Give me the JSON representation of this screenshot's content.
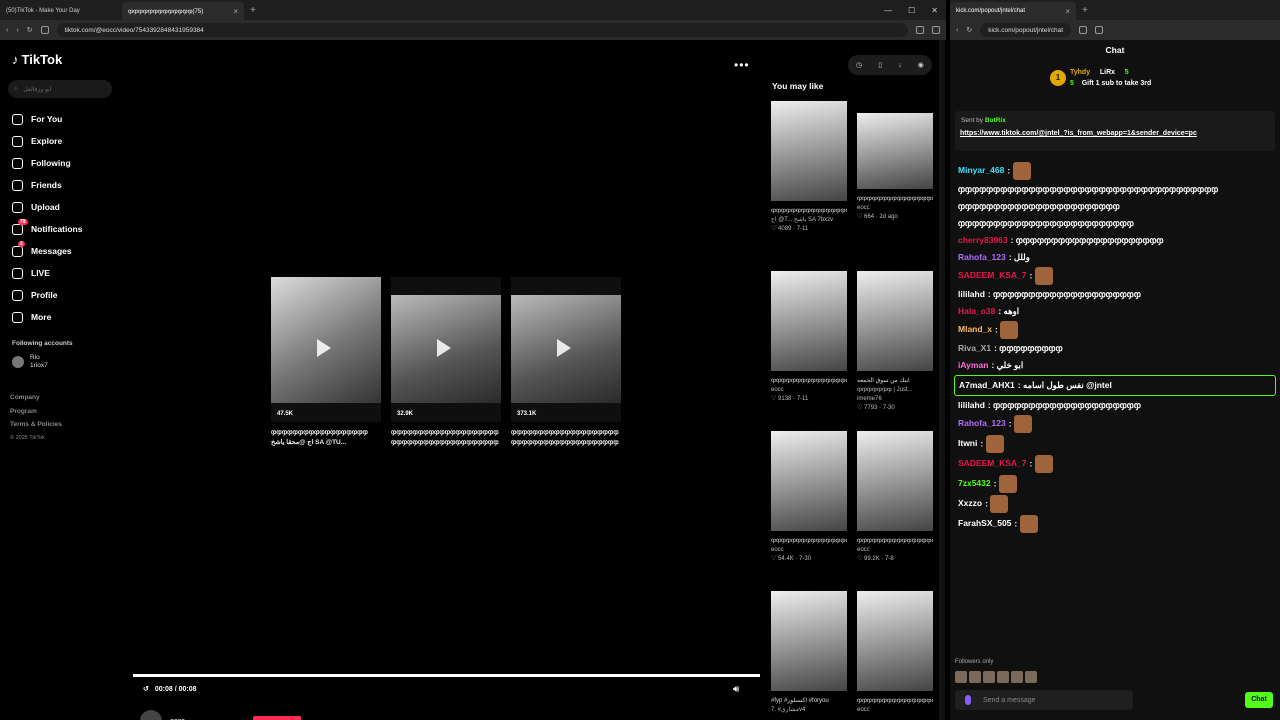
{
  "left_window": {
    "tabs": [
      {
        "label": "(50)TikTok - Make Your Day",
        "active": false
      },
      {
        "label": "ჶჶჶჶჶჶჶჶჶჶჶჶჶ(75)",
        "active": true
      }
    ],
    "url": "tiktok.com/@eocc/video/7543392848431959384"
  },
  "tiktok": {
    "logo": "TikTok",
    "search_placeholder": "ابو وزقالقل",
    "nav": [
      {
        "label": "For You",
        "icon": "home-icon"
      },
      {
        "label": "Explore",
        "icon": "compass-icon"
      },
      {
        "label": "Following",
        "icon": "following-icon"
      },
      {
        "label": "Friends",
        "icon": "friends-icon"
      },
      {
        "label": "Upload",
        "icon": "plus-square-icon"
      },
      {
        "label": "Notifications",
        "icon": "inbox-icon",
        "badge": "78"
      },
      {
        "label": "Messages",
        "icon": "send-icon",
        "badge": "2"
      },
      {
        "label": "LIVE",
        "icon": "live-icon"
      },
      {
        "label": "Profile",
        "icon": "profile-icon"
      },
      {
        "label": "More",
        "icon": "more-icon"
      }
    ],
    "following_header": "Following accounts",
    "following": [
      {
        "name": "Rio",
        "handle": "1riox7"
      }
    ],
    "footer": [
      "Company",
      "Program",
      "Terms & Policies"
    ],
    "copyright": "© 2025 TikTok",
    "cards": [
      {
        "views": "47.5K",
        "line1": "ჶჶჶჶჶჶჶჶჶჶჶჶჶჶჶჶჶჶ",
        "line2": "اج @محقا ياشخ SA @TU..."
      },
      {
        "views": "32.9K",
        "line1": "ჶჶჶჶჶჶჶჶჶჶჶჶჶჶჶჶჶჶჶჶ",
        "line2": "ჶჶჶჶჶჶჶჶჶჶჶჶჶჶჶჶჶჶჶჶ"
      },
      {
        "views": "373.1K",
        "line1": "ჶჶჶჶჶჶჶჶჶჶჶჶჶჶჶჶჶჶჶჶ",
        "line2": "ჶჶჶჶჶჶჶჶჶჶჶჶჶჶჶჶჶჶჶჶ"
      }
    ],
    "time": "00:08 / 00:08",
    "creator": "eocc",
    "you_may_like": "You may like",
    "suggestions": [
      {
        "t1": "ჶჶჶჶჶჶჶჶჶჶჶჶჶჶჶჶ",
        "t2": "اج @T... ياشخ SA 7bxzv",
        "meta": "♡ 4089 · 7-11"
      },
      {
        "t1": "ჶჶჶჶჶჶჶჶჶჶჶჶჶჶჶჶ",
        "t2": "eocc",
        "meta": "♡ 664 · 2d ago"
      },
      {
        "t1": "ჶჶჶჶჶჶჶჶჶჶჶჶჶჶჶჶ",
        "t2": "eocc",
        "meta": "♡ 9138 · 7-11"
      },
      {
        "t1": "ابيك من سوق الجمعه",
        "t2": "ჶჶჶჶჶჶჶ | Just... imeme76",
        "meta": "♡ 7793 · 7-30"
      },
      {
        "t1": "ჶჶჶჶჶჶჶჶჶჶჶჶჶჶჶჶ",
        "t2": "eocc",
        "meta": "♡ 54.4K · 7-30"
      },
      {
        "t1": "ჶჶჶჶჶჶჶჶჶჶჶჶჶჶჶჶ",
        "t2": "eocc",
        "meta": "♡ 99.2K · 7-8"
      },
      {
        "t1": "#fyp #اكسبلور #foryou",
        "t2": "مشاري# .7v4",
        "meta": ""
      },
      {
        "t1": "ჶჶჶჶჶჶჶჶჶჶჶჶჶჶჶჶ",
        "t2": "eocc",
        "meta": ""
      }
    ]
  },
  "right_window": {
    "url": "kick.com/popout/jntel/chat",
    "tab_label": "kick.com/popout/jntel/chat",
    "chat_title": "Chat",
    "gift": {
      "user": "Tyhdy",
      "count": "5",
      "other": "LiRx",
      "other_count": "5",
      "text": "Gift 1 sub to take 3rd",
      "rank": "1"
    },
    "pinned": {
      "sent_by": "Sent by",
      "bot": "BotRix",
      "link": "https://www.tiktok.com/@jntel_?is_from_webapp=1&sender_device=pc"
    },
    "messages": [
      {
        "user": "Minyar_468",
        "color": "#3ee0ff",
        "text": ""
      },
      {
        "user": "",
        "color": "#fff",
        "text": "ჶჶჶჶჶჶჶჶჶჶჶჶჶჶჶჶჶჶჶჶჶჶჶჶჶჶჶჶჶჶჶჶჶჶჶჶჶ"
      },
      {
        "user": "",
        "color": "#fff",
        "text": "ჶჶჶჶჶჶჶჶჶჶჶჶჶჶჶჶჶჶჶჶჶჶჶ"
      },
      {
        "user": "",
        "color": "#fff",
        "text": "ჶჶჶჶჶჶჶჶჶჶჶჶჶჶჶჶჶჶჶჶჶჶჶჶჶ"
      },
      {
        "user": "cherry83963",
        "color": "#e8174b",
        "text": "ჶჶჶჶჶჶჶჶჶჶჶჶჶჶჶჶჶჶჶჶჶ"
      },
      {
        "user": "Rahofa_123",
        "color": "#b26bff",
        "text": "وللل"
      },
      {
        "user": "SADEEM_KSA_7",
        "color": "#e8174b",
        "text": ""
      },
      {
        "user": "lililahd",
        "color": "#fff",
        "text": "ჶჶჶჶჶჶჶჶჶჶჶჶჶჶჶჶჶჶჶჶჶ"
      },
      {
        "user": "Hala_o38",
        "color": "#e8174b",
        "text": "اوهه"
      },
      {
        "user": "Mland_x",
        "color": "#ffb86b",
        "text": ""
      },
      {
        "user": "Riva_X1",
        "color": "#aaa",
        "text": "ჶჶჶჶჶჶჶჶჶ"
      },
      {
        "user": "iAyman",
        "color": "#ff6fd8",
        "text": "ابو خلي"
      },
      {
        "user": "A7mad_AHX1",
        "color": "#fff",
        "text": "نفس طول اسامه @jntel",
        "highlight": true
      },
      {
        "user": "lililahd",
        "color": "#fff",
        "text": "ჶჶჶჶჶჶჶჶჶჶჶჶჶჶჶჶჶჶჶჶჶ"
      },
      {
        "user": "Rahofa_123",
        "color": "#b26bff",
        "text": ""
      },
      {
        "user": "Itwni",
        "color": "#fff",
        "text": ""
      },
      {
        "user": "SADEEM_KSA_7",
        "color": "#e8174b",
        "text": ""
      },
      {
        "user": "7zx5432",
        "color": "#53fc18",
        "text": ""
      },
      {
        "user": "Xxzzo",
        "color": "#fff",
        "text": ""
      },
      {
        "user": "FarahSX_505",
        "color": "#fff",
        "text": ""
      }
    ],
    "followers_only": "Followers only",
    "input_placeholder": "Send a message",
    "chat_button": "Chat"
  }
}
